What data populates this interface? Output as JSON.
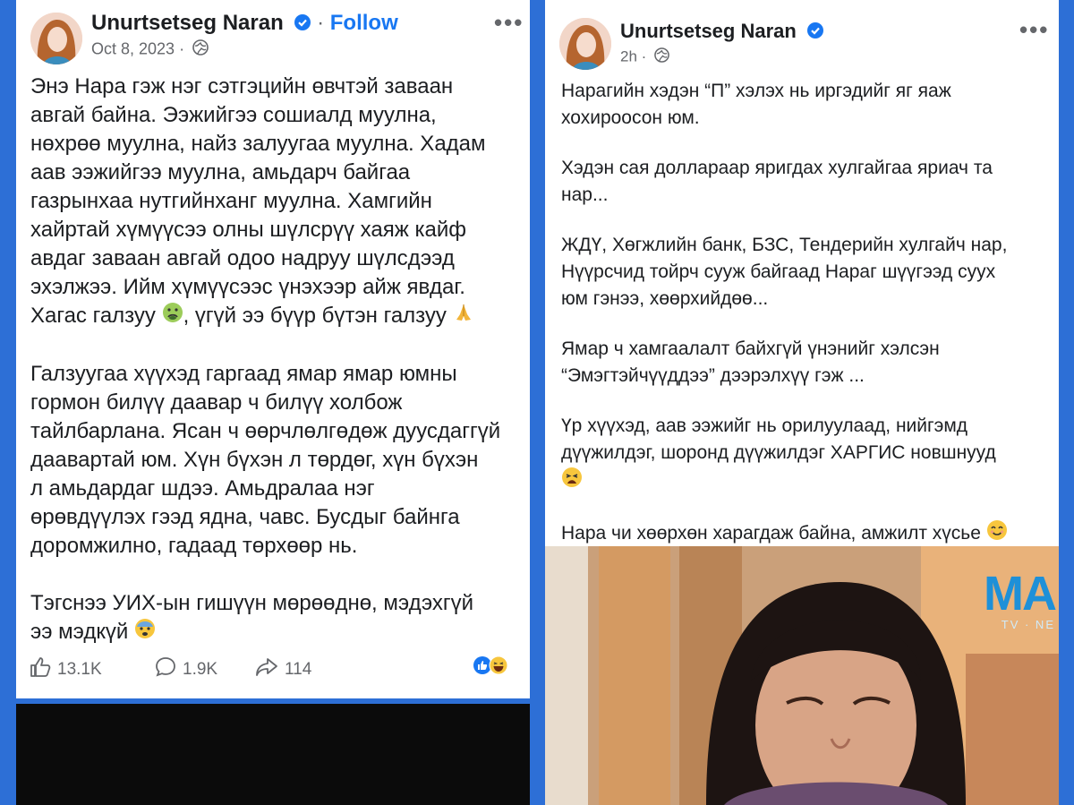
{
  "left_post": {
    "author": "Unurtsetseg Naran",
    "follow_label": "Follow",
    "date": "Oct 8, 2023",
    "more": "•••",
    "paragraphs": [
      [
        "Энэ Нара гэж нэг сэтгэцийн өвчтэй заваан",
        "авгай байна. Ээжийгээ сошиалд муулна,",
        "нөхрөө муулна, найз залуугаа муулна. Хадам",
        "аав ээжийгээ муулна, амьдарч байгаа",
        "газрынхаа нутгийнханг муулна. Хамгийн",
        "хайртай хүмүүсээ олны шүлсрүү хаяж кайф",
        "авдаг заваан авгай одоо надруу шүлсдээд",
        "эхэлжээ. Ийм хүмүүсээс үнэхээр айж явдаг."
      ],
      [
        "Галзуугаа хүүхэд гаргаад ямар ямар юмны",
        "гормон билүү даавар ч билүү холбож",
        "тайлбарлана. Ясан ч өөрчлөлгөдөж дуусдаггүй",
        "даавартай юм. Хүн бүхэн л төрдөг, хүн бүхэн",
        "л амьдардаг шдээ. Амьдралаа нэг",
        "өрөвдүүлэх гээд ядна, чавс. Бусдыг байнга",
        "доромжилно, гадаад төрхөөр нь."
      ],
      [
        "Тэгснээ УИХ-ын гишүүн мөрөөднө, мэдэхгүй"
      ]
    ],
    "line_hagas_1": "Хагас галзуу",
    "line_hagas_2": ", үгүй ээ бүүр бүтэн галзуу",
    "line_last": "ээ мэдкүй",
    "likes": "13.1K",
    "comments": "1.9K",
    "shares": "114"
  },
  "right_post": {
    "author": "Unurtsetseg Naran",
    "time": "2h",
    "more": "•••",
    "paragraphs": [
      [
        "Нарагийн хэдэн “П”  хэлэх нь иргэдийг яг яаж",
        "хохироосон юм."
      ],
      [
        "Хэдэн сая доллараар яригдах хулгайгаа яриач та",
        "нар..."
      ],
      [
        "ЖДҮ, Хөгжлийн банк, БЗС, Тендерийн хулгайч нар,",
        "Нүүрсчид тойрч сууж байгаад  Нараг шүүгээд суух",
        "юм гэнээ, хөөрхийдөө..."
      ],
      [
        "Ямар ч хамгаалалт  байхгүй үнэнийг хэлсэн",
        "“Эмэгтэйчүүддээ” дээрэлхүү гэж ..."
      ],
      [
        "Үр хүүхэд, аав ээжийг нь орилуулаад, нийгэмд",
        "дүүжилдэг, шоронд дүүжилдэг ХАРГИС новшнууд"
      ]
    ],
    "line_final": "Нара чи хөөрхөн харагдаж байна, амжилт хүсье",
    "tv_logo": "MA",
    "tv_sub": "TV · NE"
  },
  "colors": {
    "facebook_blue": "#1877f2",
    "meta_gray": "#65676b",
    "background": "#2d6fd6"
  },
  "icons": [
    "verified-badge-icon",
    "globe-icon",
    "more-icon",
    "like-icon",
    "comment-icon",
    "share-icon",
    "like-reaction-icon",
    "haha-reaction-icon",
    "emoji-nauseated",
    "emoji-praying-hands",
    "emoji-fearful",
    "emoji-tired",
    "emoji-smiling"
  ]
}
